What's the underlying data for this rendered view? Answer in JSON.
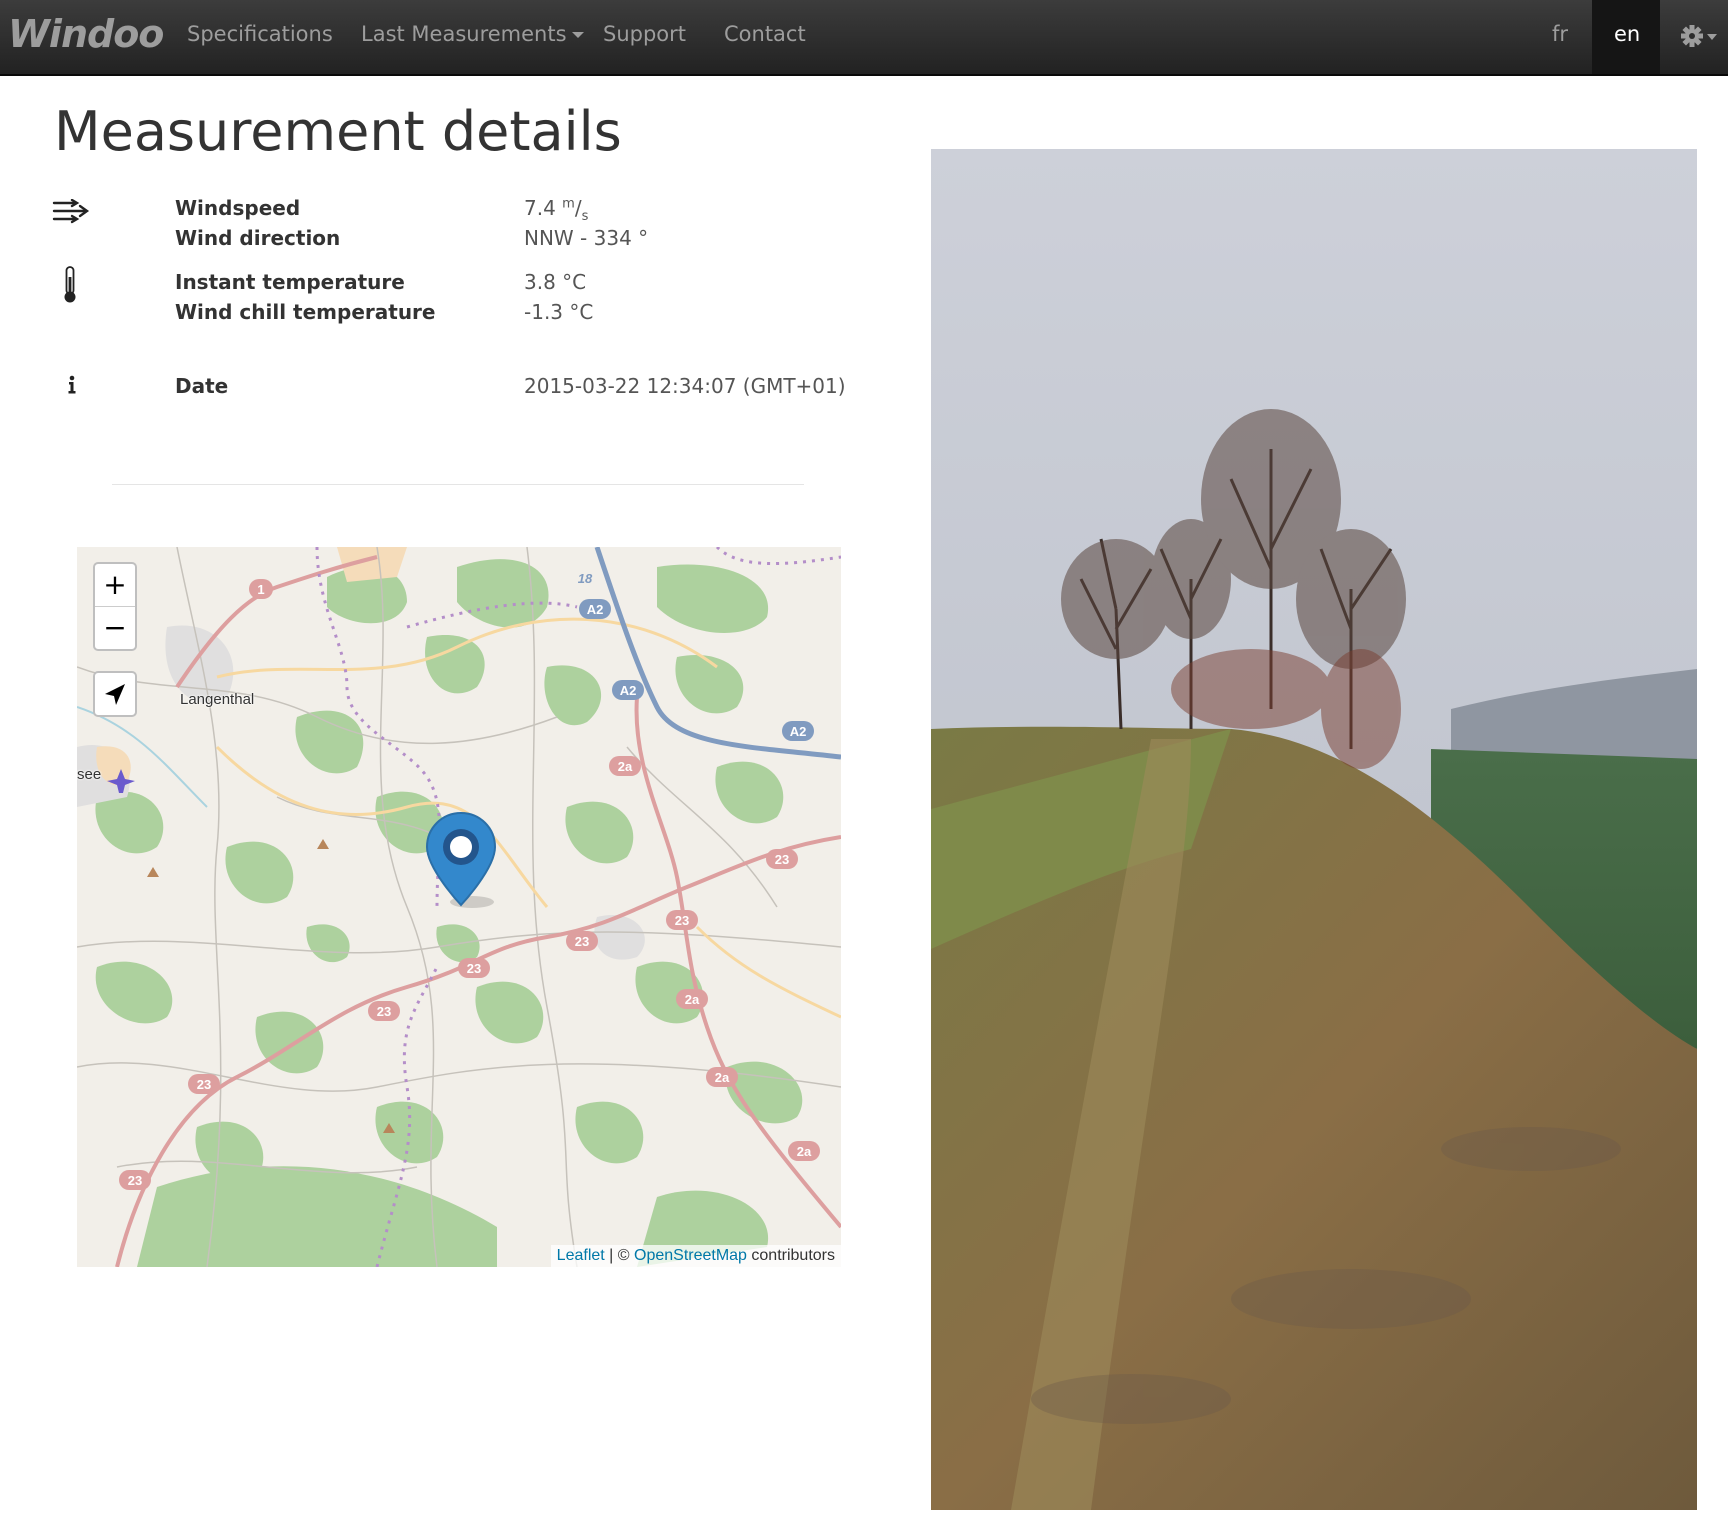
{
  "navbar": {
    "brand": "Windoo",
    "links": [
      "Specifications",
      "Last Measurements",
      "Support",
      "Contact"
    ],
    "languages": [
      "fr",
      "en"
    ],
    "active_language": "en"
  },
  "page": {
    "title": "Measurement details"
  },
  "details": {
    "windspeed_label": "Windspeed",
    "windspeed_value": "7.4",
    "windspeed_unit_num": "m",
    "windspeed_unit_den": "s",
    "wind_direction_label": "Wind direction",
    "wind_direction_value": "NNW - 334 °",
    "instant_temp_label": "Instant temperature",
    "instant_temp_value": "3.8 °C",
    "wind_chill_label": "Wind chill temperature",
    "wind_chill_value": "-1.3 °C",
    "date_label": "Date",
    "date_value": "2015-03-22 12:34:07 (GMT+01)"
  },
  "map": {
    "zoom_in": "+",
    "zoom_out": "−",
    "place_langenthal": "Langenthal",
    "place_see": "see",
    "road_labels": [
      "1",
      "18",
      "A2",
      "A2",
      "A2",
      "2a",
      "2a",
      "2a",
      "2a",
      "23",
      "23",
      "23",
      "23",
      "23",
      "23",
      "23"
    ],
    "attribution_leaflet": "Leaflet",
    "attribution_sep": " | © ",
    "attribution_osm": "OpenStreetMap",
    "attribution_suffix": " contributors"
  },
  "colors": {
    "navbar": "#222222",
    "nav_text": "#9d9d9d",
    "marker": "#3388cc",
    "link": "#0078a8"
  }
}
